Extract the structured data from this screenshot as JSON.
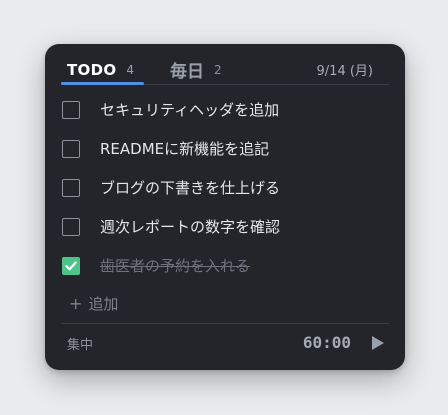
{
  "tabs": [
    {
      "label": "TODO",
      "count": "4"
    },
    {
      "label": "毎日",
      "count": "2"
    }
  ],
  "date": "9/14 (月)",
  "tasks": [
    {
      "text": "セキュリティヘッダを追加",
      "done": false
    },
    {
      "text": "READMEに新機能を追記",
      "done": false
    },
    {
      "text": "ブログの下書きを仕上げる",
      "done": false
    },
    {
      "text": "週次レポートの数字を確認",
      "done": false
    },
    {
      "text": "歯医者の予約を入れる",
      "done": true
    }
  ],
  "add_label": "追加",
  "add_icon": "plus-icon",
  "footer": {
    "focus_label": "集中",
    "timer": "60:00",
    "play_icon": "play-icon"
  },
  "colors": {
    "accent": "#4f8fe6",
    "check": "#4cc48a",
    "panel": "#23252b"
  }
}
